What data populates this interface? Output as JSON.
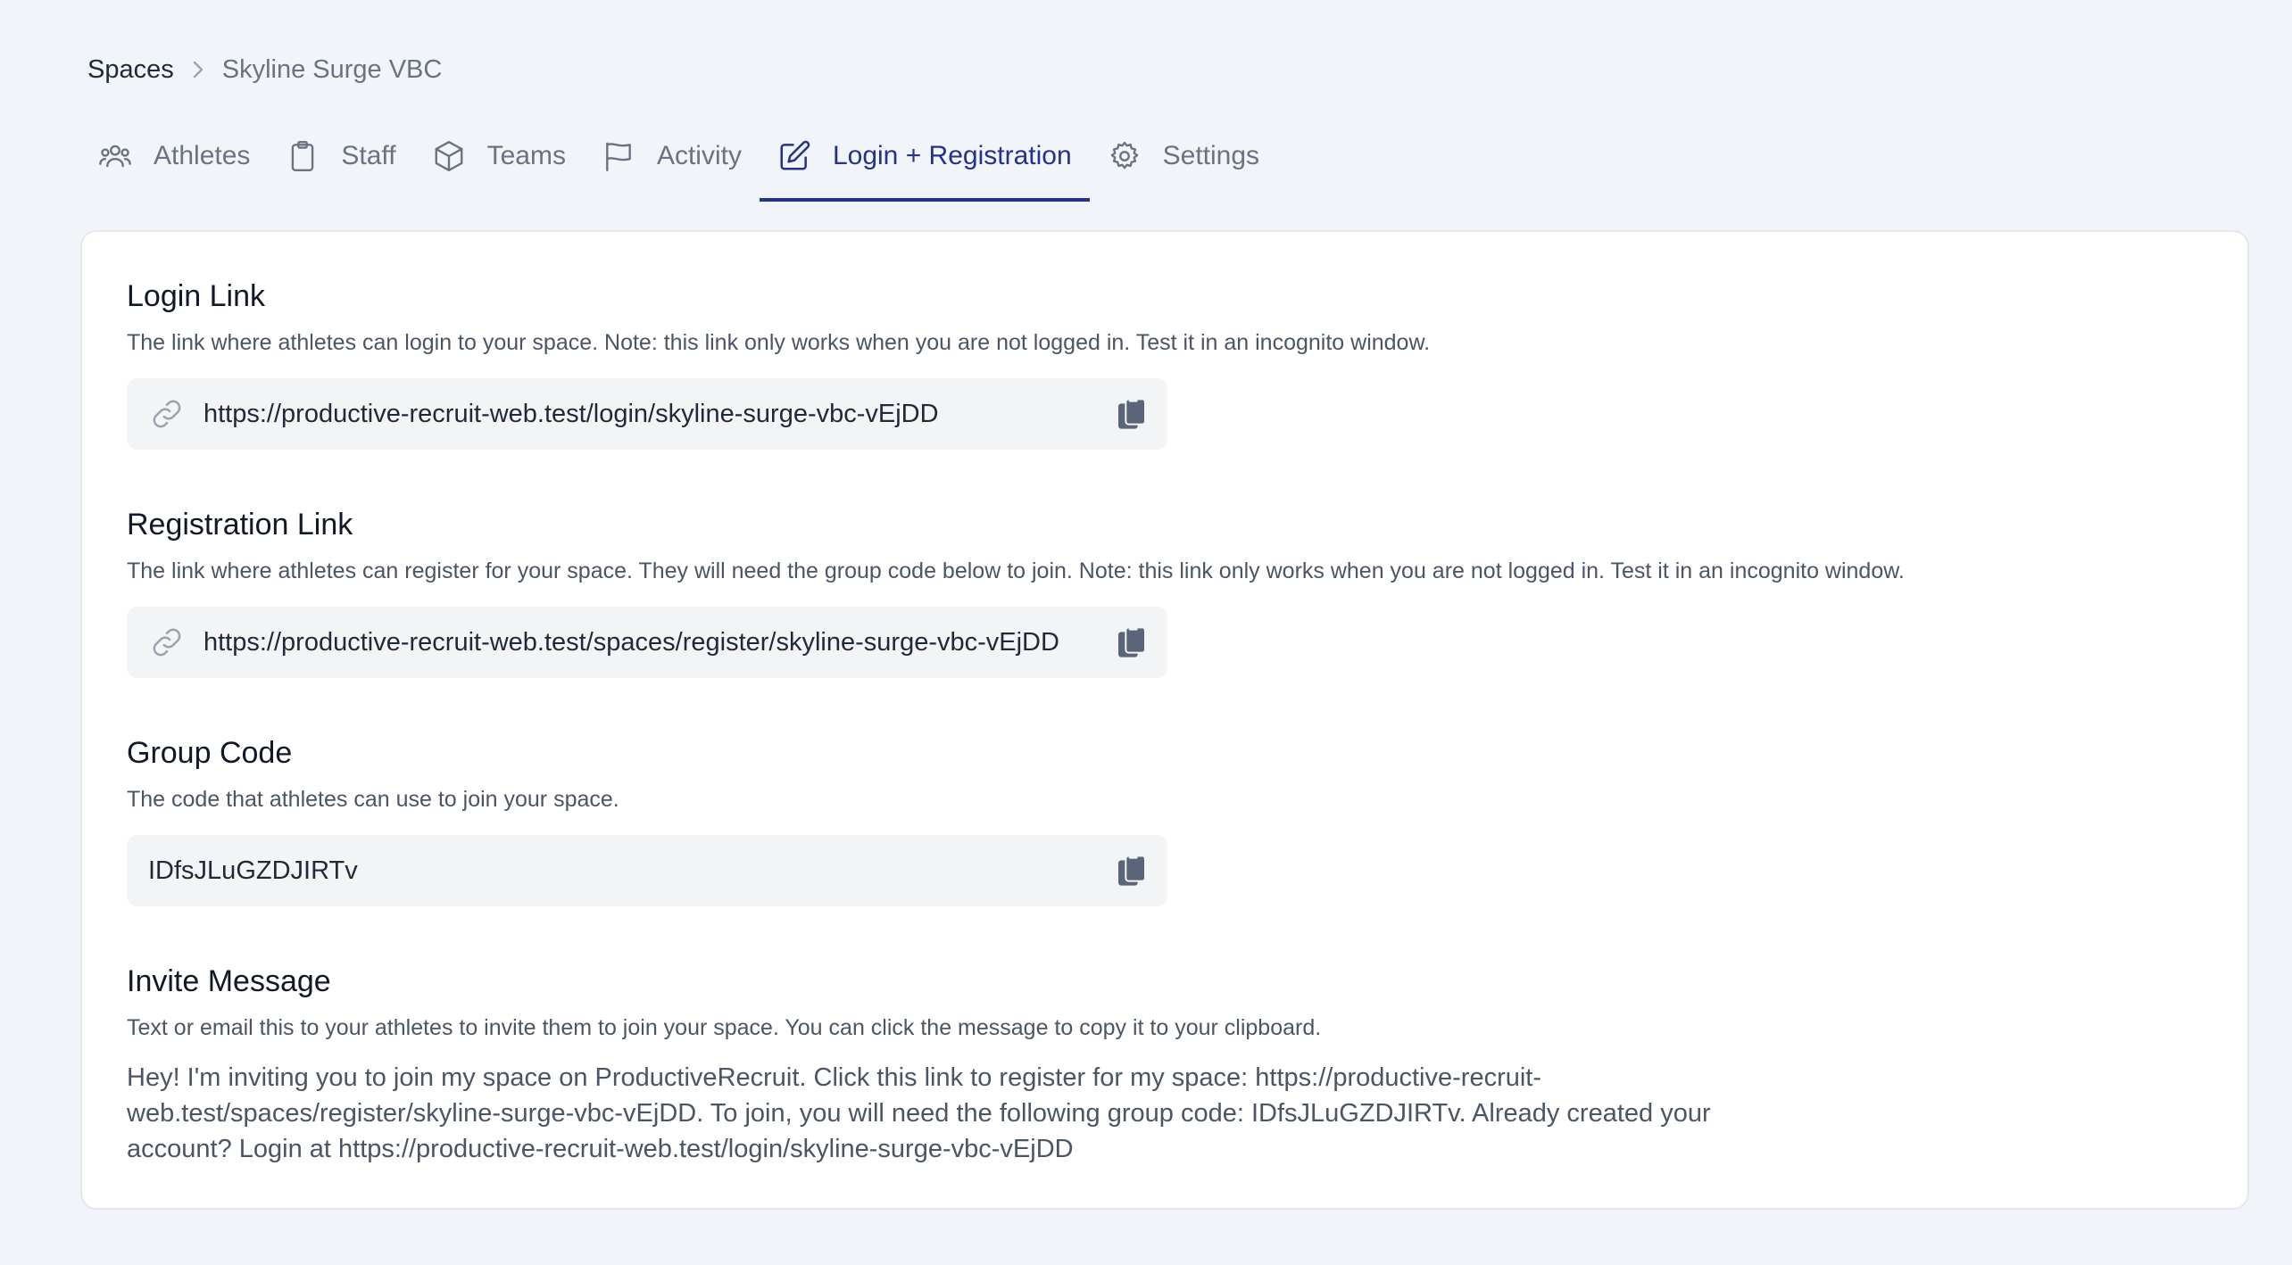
{
  "breadcrumb": {
    "root": "Spaces",
    "current": "Skyline Surge VBC"
  },
  "tabs": [
    {
      "label": "Athletes",
      "icon": "users-icon"
    },
    {
      "label": "Staff",
      "icon": "clipboard-icon"
    },
    {
      "label": "Teams",
      "icon": "cube-icon"
    },
    {
      "label": "Activity",
      "icon": "flag-icon"
    },
    {
      "label": "Login + Registration",
      "icon": "edit-icon",
      "active": true
    },
    {
      "label": "Settings",
      "icon": "gear-icon"
    }
  ],
  "login": {
    "title": "Login Link",
    "description": "The link where athletes can login to your space. Note: this link only works when you are not logged in. Test it in an incognito window.",
    "url": "https://productive-recruit-web.test/login/skyline-surge-vbc-vEjDD"
  },
  "registration": {
    "title": "Registration Link",
    "description": "The link where athletes can register for your space. They will need the group code below to join. Note: this link only works when you are not logged in. Test it in an incognito window.",
    "url": "https://productive-recruit-web.test/spaces/register/skyline-surge-vbc-vEjDD"
  },
  "group_code": {
    "title": "Group Code",
    "description": "The code that athletes can use to join your space.",
    "code": "IDfsJLuGZDJIRTv"
  },
  "invite": {
    "title": "Invite Message",
    "description": "Text or email this to your athletes to invite them to join your space. You can click the message to copy it to your clipboard.",
    "message": "Hey! I'm inviting you to join my space on ProductiveRecruit. Click this link to register for my space: https://productive-recruit-web.test/spaces/register/skyline-surge-vbc-vEjDD. To join, you will need the following group code: IDfsJLuGZDJIRTv. Already created your account? Login at https://productive-recruit-web.test/login/skyline-surge-vbc-vEjDD"
  },
  "colors": {
    "background": "#f1f4f9",
    "active_tab": "#25318a",
    "field_bg": "#f3f4f6",
    "muted_text": "#6b7280",
    "copy_icon": "#5b6478"
  }
}
